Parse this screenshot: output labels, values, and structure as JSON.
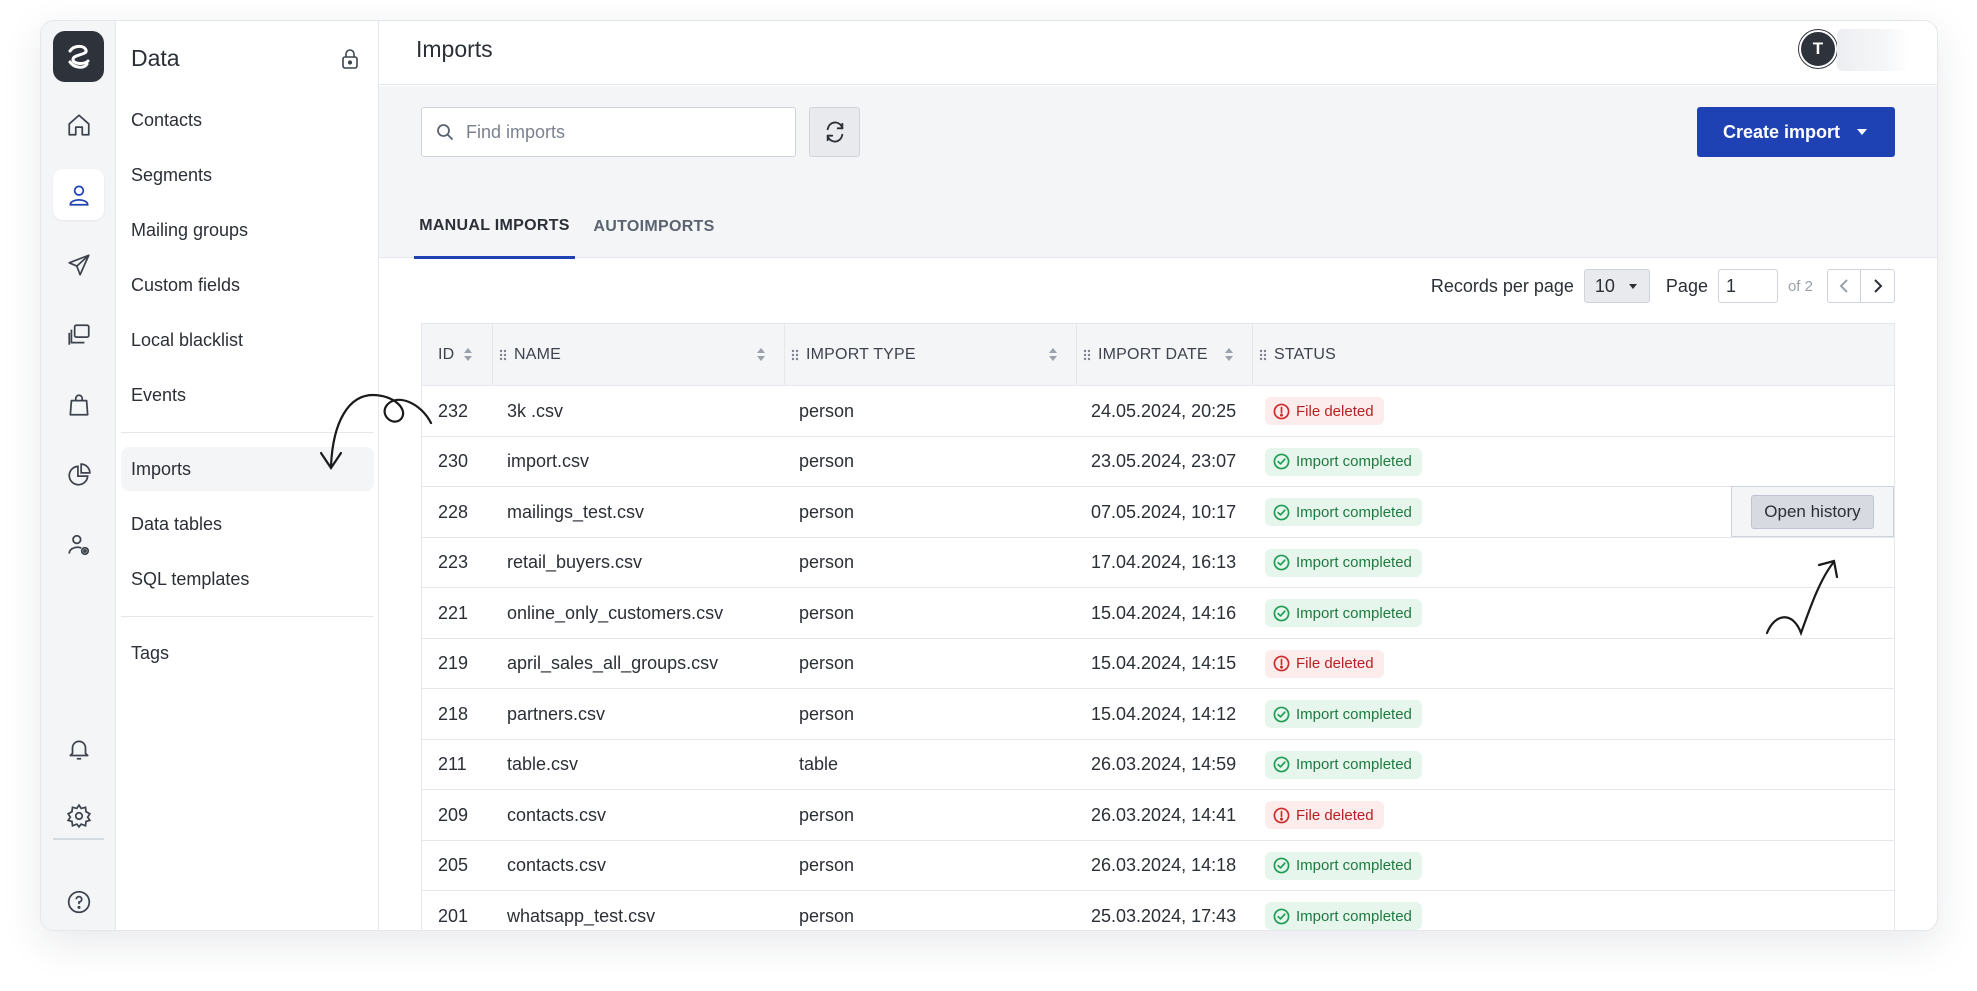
{
  "app": {
    "logo": "app-logo"
  },
  "rail": {
    "icons": [
      "home-icon",
      "contacts-person-icon",
      "send-icon",
      "copy-windows-icon",
      "shopping-bag-icon",
      "pie-chart-icon",
      "user-settings-icon",
      "bell-icon",
      "gear-icon",
      "help-icon"
    ]
  },
  "sidebar": {
    "title": "Data",
    "items": [
      {
        "label": "Contacts"
      },
      {
        "label": "Segments"
      },
      {
        "label": "Mailing groups"
      },
      {
        "label": "Custom fields"
      },
      {
        "label": "Local blacklist"
      },
      {
        "label": "Events"
      },
      {
        "label": "Imports",
        "active": true
      },
      {
        "label": "Data tables"
      },
      {
        "label": "SQL templates"
      },
      {
        "label": "Tags"
      }
    ]
  },
  "header": {
    "title": "Imports",
    "avatar_initial": "T"
  },
  "toolbar": {
    "search_placeholder": "Find imports",
    "create_label": "Create import"
  },
  "tabs": [
    {
      "label": "MANUAL IMPORTS",
      "active": true
    },
    {
      "label": "AUTOIMPORTS",
      "active": false
    }
  ],
  "pagination": {
    "records_label": "Records per page",
    "per_page": "10",
    "page_label": "Page",
    "page": "1",
    "of_label": "of 2"
  },
  "table": {
    "columns": [
      "ID",
      "NAME",
      "IMPORT TYPE",
      "IMPORT DATE",
      "STATUS"
    ],
    "rows": [
      {
        "id": "232",
        "name": "3k .csv",
        "type": "person",
        "date": "24.05.2024, 20:25",
        "status": "File deleted",
        "status_kind": "deleted"
      },
      {
        "id": "230",
        "name": "import.csv",
        "type": "person",
        "date": "23.05.2024, 23:07",
        "status": "Import completed",
        "status_kind": "completed"
      },
      {
        "id": "228",
        "name": "mailings_test.csv",
        "type": "person",
        "date": "07.05.2024, 10:17",
        "status": "Import completed",
        "status_kind": "completed"
      },
      {
        "id": "223",
        "name": "retail_buyers.csv",
        "type": "person",
        "date": "17.04.2024, 16:13",
        "status": "Import completed",
        "status_kind": "completed"
      },
      {
        "id": "221",
        "name": "online_only_customers.csv",
        "type": "person",
        "date": "15.04.2024, 14:16",
        "status": "Import completed",
        "status_kind": "completed"
      },
      {
        "id": "219",
        "name": "april_sales_all_groups.csv",
        "type": "person",
        "date": "15.04.2024, 14:15",
        "status": "File deleted",
        "status_kind": "deleted"
      },
      {
        "id": "218",
        "name": "partners.csv",
        "type": "person",
        "date": "15.04.2024, 14:12",
        "status": "Import completed",
        "status_kind": "completed"
      },
      {
        "id": "211",
        "name": "table.csv",
        "type": "table",
        "date": "26.03.2024, 14:59",
        "status": "Import completed",
        "status_kind": "completed"
      },
      {
        "id": "209",
        "name": "contacts.csv",
        "type": "person",
        "date": "26.03.2024, 14:41",
        "status": "File deleted",
        "status_kind": "deleted"
      },
      {
        "id": "205",
        "name": "contacts.csv",
        "type": "person",
        "date": "26.03.2024, 14:18",
        "status": "Import completed",
        "status_kind": "completed"
      },
      {
        "id": "201",
        "name": "whatsapp_test.csv",
        "type": "person",
        "date": "25.03.2024, 17:43",
        "status": "Import completed",
        "status_kind": "completed"
      }
    ],
    "hover_action": "Open history"
  },
  "colors": {
    "primary": "#1e42b4",
    "completed_bg": "#e7f6ec",
    "completed_fg": "#1f7a42",
    "deleted_bg": "#fdecec",
    "deleted_fg": "#b42323"
  }
}
